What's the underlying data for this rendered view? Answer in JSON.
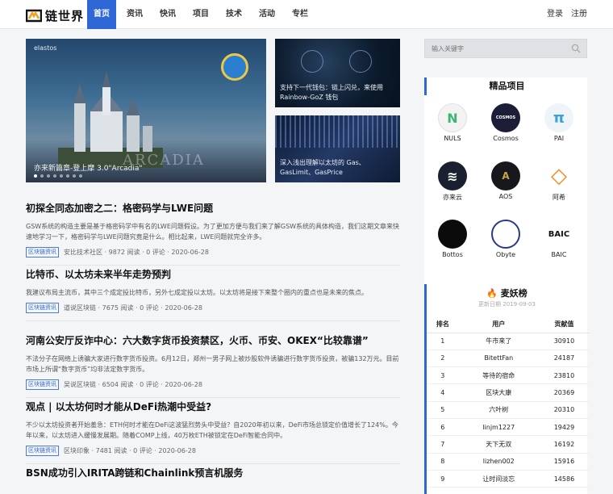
{
  "header": {
    "logo_text": "链世界",
    "nav": [
      "首页",
      "资讯",
      "快讯",
      "项目",
      "技术",
      "活动",
      "专栏"
    ],
    "active_nav": "首页",
    "login": "登录",
    "register": "注册"
  },
  "carousel": {
    "brand": "elastos",
    "image_text": "ARCADIA",
    "caption": "亦来新篇章-登上摩 3.0\"Arcadia\""
  },
  "thumbs": [
    {
      "caption": "支持下一代钱包：链上闪兑，来使用 Rainbow-GoZ 钱包"
    },
    {
      "caption": "深入浅出理解以太坊的 Gas、GasLimit、GasPrice"
    }
  ],
  "articles": [
    {
      "title": "初探全同态加密之二：格密码学与LWE问题",
      "summary": "GSW系统的构造主要是基于格密码学中有名的LWE问题假设。为了更加方便与我们来了解GSW系统的具体构造，我们这期文章来快速地学习一下，格密码学与LWE问题究竟是什么。相比起来，LWE问题就完全许多。",
      "tag": "区块链资讯",
      "meta": "安比技术社区 · 9872 阅读 · 0 评论 · 2020-06-28"
    },
    {
      "title": "比特币、以太坊未来半年走势预判",
      "summary": "我建议布局主流币，其中三个成定投比特币，另外七成定投以太坊。以太坊将是接下来整个圈内的重点也是未来的焦点。",
      "tag": "区块链资讯",
      "meta": "道说区块链 · 7675 阅读 · 0 评论 · 2020-06-28"
    },
    {
      "title": "河南公安厅反诈中心：六大数字货币投资禁区，火币、币安、OKEX“比较靠谱”",
      "summary": "不法分子在网络上诱骗大家进行数字货币投资。6月12日，郑州一男子网上被炒股软件诱骗进行数字货币投资，被骗132万元。目前市场上所谓“数字货币”均非法定数字货币。",
      "tag": "区块链资讯",
      "meta": "吴说区块链 · 6504 阅读 · 0 评论 · 2020-06-28"
    },
    {
      "title": "观点 | 以太坊何时才能从DeFi热潮中受益?",
      "summary": "不少以太坊投资者开始羞急：ETH何时才能在DeFi这波猛烈势头中受益？自2020年初以来，DeFi市场总锁定价值增长了124%。今年以来，以太坊进入缓慢发展期。随着COMP上线，40万枚ETH被锁定在DeFi智能合同中。",
      "tag": "区块链资讯",
      "meta": "区块印象 · 7481 阅读 · 0 评论 · 2020-06-28"
    },
    {
      "title": "BSN成功引入IRITA跨链和Chainlink预言机服务",
      "summary": "",
      "tag": "",
      "meta": ""
    }
  ],
  "search": {
    "placeholder": "输入关键字"
  },
  "projects": {
    "title": "精品项目",
    "items": [
      {
        "name": "NULS",
        "mark": "N",
        "bg": "#f2f3f2",
        "fg": "#3cb56f"
      },
      {
        "name": "Cosmos",
        "mark": "COSMOS",
        "bg": "#1b1e36",
        "fg": "#ffffff"
      },
      {
        "name": "PAI",
        "mark": "π",
        "bg": "#eef4f8",
        "fg": "#3ea0d9"
      },
      {
        "name": "亦来云",
        "mark": "≋",
        "bg": "#1a2030",
        "fg": "#ffffff"
      },
      {
        "name": "AOS",
        "mark": "A",
        "bg": "#16181c",
        "fg": "#c9a44b"
      },
      {
        "name": "阿希",
        "mark": "◇",
        "bg": "#ffffff",
        "fg": "#f08a1c"
      },
      {
        "name": "Bottos",
        "mark": "",
        "bg": "#0b0b0b",
        "fg": "#ffffff"
      },
      {
        "name": "Obyte",
        "mark": "",
        "bg": "#ffffff",
        "fg": "#2a3a8a"
      },
      {
        "name": "BAIC",
        "mark": "BAIC",
        "bg": "#ffffff",
        "fg": "#111111"
      }
    ]
  },
  "ranking": {
    "title": "麦妖榜",
    "updated": "更新日期 2019-09-03",
    "headers": [
      "排名",
      "用户",
      "贡献值"
    ],
    "rows": [
      [
        "1",
        "牛市来了",
        "30910"
      ],
      [
        "2",
        "BitettFan",
        "24187"
      ],
      [
        "3",
        "等待的宿命",
        "23810"
      ],
      [
        "4",
        "区块大康",
        "20369"
      ],
      [
        "5",
        "六叶树",
        "20310"
      ],
      [
        "6",
        "linjm1227",
        "19429"
      ],
      [
        "7",
        "天下无双",
        "16192"
      ],
      [
        "8",
        "lizhen002",
        "15916"
      ],
      [
        "9",
        "让时间淡忘",
        "14586"
      ]
    ]
  }
}
